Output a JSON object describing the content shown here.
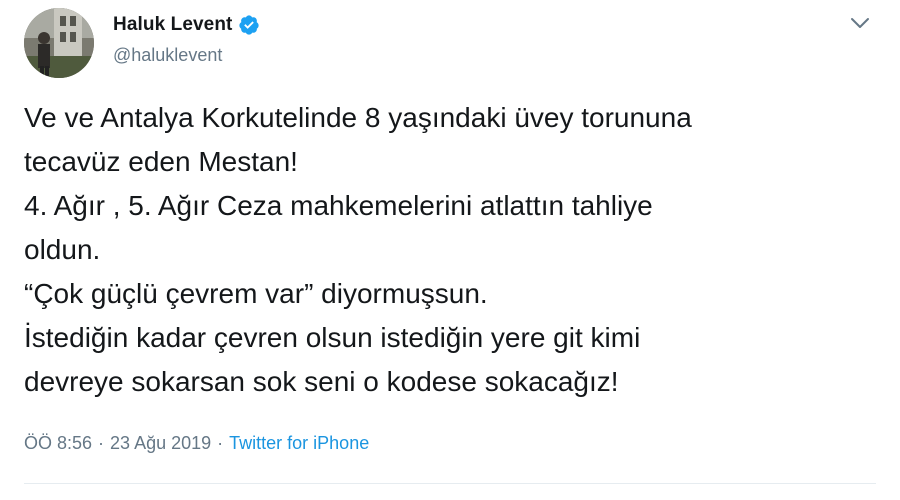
{
  "user": {
    "display_name": "Haluk Levent",
    "handle": "@haluklevent",
    "verified": true
  },
  "tweet": {
    "lines": [
      "Ve ve Antalya Korkutelinde 8 yaşındaki üvey torununa",
      "tecavüz eden Mestan!",
      "4. Ağır , 5. Ağır Ceza mahkemelerini atlattın tahliye",
      "oldun.",
      "“Çok güçlü çevrem var” diyormuşsun.",
      "İstediğin kadar çevren olsun istediğin yere git kimi",
      "devreye sokarsan sok seni o kodese sokacağız!"
    ],
    "time": "ÖÖ 8:56",
    "separator": "·",
    "date": "23 Ağu 2019",
    "source": "Twitter for iPhone"
  },
  "icons": {
    "verified_badge": "verified-badge-icon",
    "menu": "chevron-down-icon"
  },
  "colors": {
    "verified": "#1da1f2",
    "link": "#1b95e0",
    "secondary_text": "#657786",
    "primary_text": "#14171a"
  }
}
